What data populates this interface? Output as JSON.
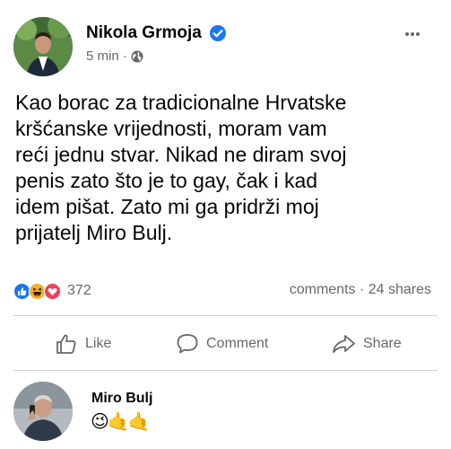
{
  "post": {
    "author": "Nikola Grmoja",
    "time": "5 min",
    "separator": "·",
    "privacy_icon": "globe-icon",
    "verified_icon": "verified-badge-icon",
    "more_icon": "more-dots-icon",
    "text": "Kao borac za tradicionalne Hrvatske\nkršćanske vrijednosti, moram vam\nreći jednu stvar. Nikad ne diram svoj\npenis zato što je to gay, čak i kad\nidem pišat. Zato mi ga pridrži moj\nprijatelj Miro Bulj."
  },
  "engagement": {
    "reaction_icons": [
      "like-reaction-icon",
      "haha-reaction-icon",
      "love-reaction-icon"
    ],
    "reaction_count": "372",
    "stats": "comments · 24 shares"
  },
  "actions": {
    "like": "Like",
    "comment": "Comment",
    "share": "Share"
  },
  "comment": {
    "author": "Miro Bulj",
    "text": "😉🤙🤙"
  },
  "colors": {
    "facebook_blue": "#1877f2",
    "secondary_text": "#65676b",
    "divider": "#ced0d4",
    "love_red": "#f33e58",
    "haha_yellow": "#f7b125"
  }
}
